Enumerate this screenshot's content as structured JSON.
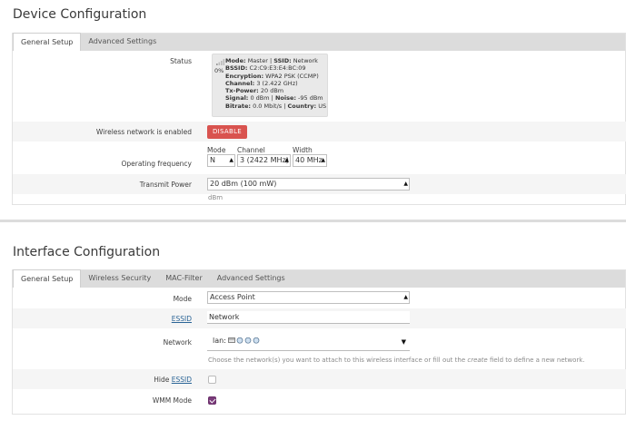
{
  "device": {
    "title": "Device Configuration",
    "tabs": [
      "General Setup",
      "Advanced Settings"
    ],
    "status_label": "Status",
    "status": {
      "percent": "0%",
      "mode_label": "Mode:",
      "mode_value": "Master",
      "ssid_label": "SSID:",
      "ssid_value": "Network",
      "bssid_label": "BSSID:",
      "bssid_value": "C2:C9:E3:E4:BC:09",
      "encryption_label": "Encryption:",
      "encryption_value": "WPA2 PSK (CCMP)",
      "channel_label": "Channel:",
      "channel_value": "3 (2.422 GHz)",
      "txpower_label": "Tx-Power:",
      "txpower_value": "20 dBm",
      "signal_label": "Signal:",
      "signal_value": "0 dBm",
      "noise_label": "Noise:",
      "noise_value": "-95 dBm",
      "bitrate_label": "Bitrate:",
      "bitrate_value": "0.0 Mbit/s",
      "country_label": "Country:",
      "country_value": "US"
    },
    "wireless_label": "Wireless network is enabled",
    "disable_button": "DISABLE",
    "freq_label": "Operating frequency",
    "mode_sub": "Mode",
    "mode_value": "N",
    "channel_sub": "Channel",
    "channel_value": "3 (2422 MHz)",
    "width_sub": "Width",
    "width_value": "40 MHz",
    "txpower_label": "Transmit Power",
    "txpower_value": "20 dBm (100 mW)",
    "txpower_unit": "dBm"
  },
  "interface": {
    "title": "Interface Configuration",
    "tabs": [
      "General Setup",
      "Wireless Security",
      "MAC-Filter",
      "Advanced Settings"
    ],
    "mode_label": "Mode",
    "mode_value": "Access Point",
    "essid_label": "ESSID",
    "essid_value": "Network",
    "network_label": "Network",
    "network_value": "lan:",
    "network_hint_pre": "Choose the network(s) you want to attach to this wireless interface or fill out the ",
    "network_hint_em": "create",
    "network_hint_post": " field to define a new network.",
    "hide_label": "Hide",
    "hide_link": "ESSID",
    "hide_checked": false,
    "wmm_label": "WMM Mode",
    "wmm_checked": true
  },
  "colors": {
    "accent": "#7a3b7a",
    "danger": "#d9534f",
    "tabbar": "#dcdcdc",
    "link": "#2a6496"
  },
  "icons": [
    "signal-icon",
    "network-interface-icon",
    "dropdown-arrow-icon",
    "checkmark-icon"
  ]
}
